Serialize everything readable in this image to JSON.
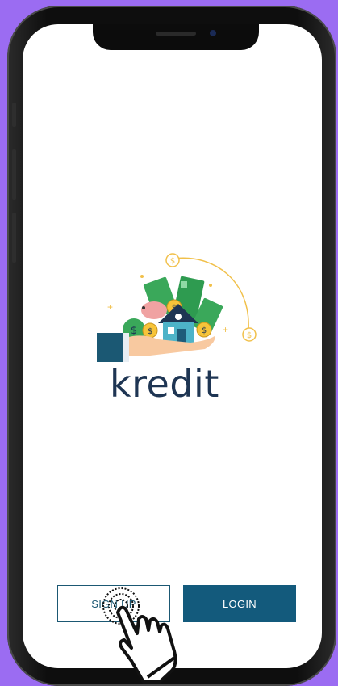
{
  "app": {
    "brand_name": "kredit"
  },
  "buttons": {
    "signup_label": "SIGN UP",
    "login_label": "LOGIN"
  },
  "colors": {
    "background": "#9b6cf2",
    "primary": "#135a7c",
    "brand_text": "#1e3553"
  },
  "icons": {
    "logo": "money-house-in-hand-logo",
    "pointer": "tap-hand-icon"
  }
}
